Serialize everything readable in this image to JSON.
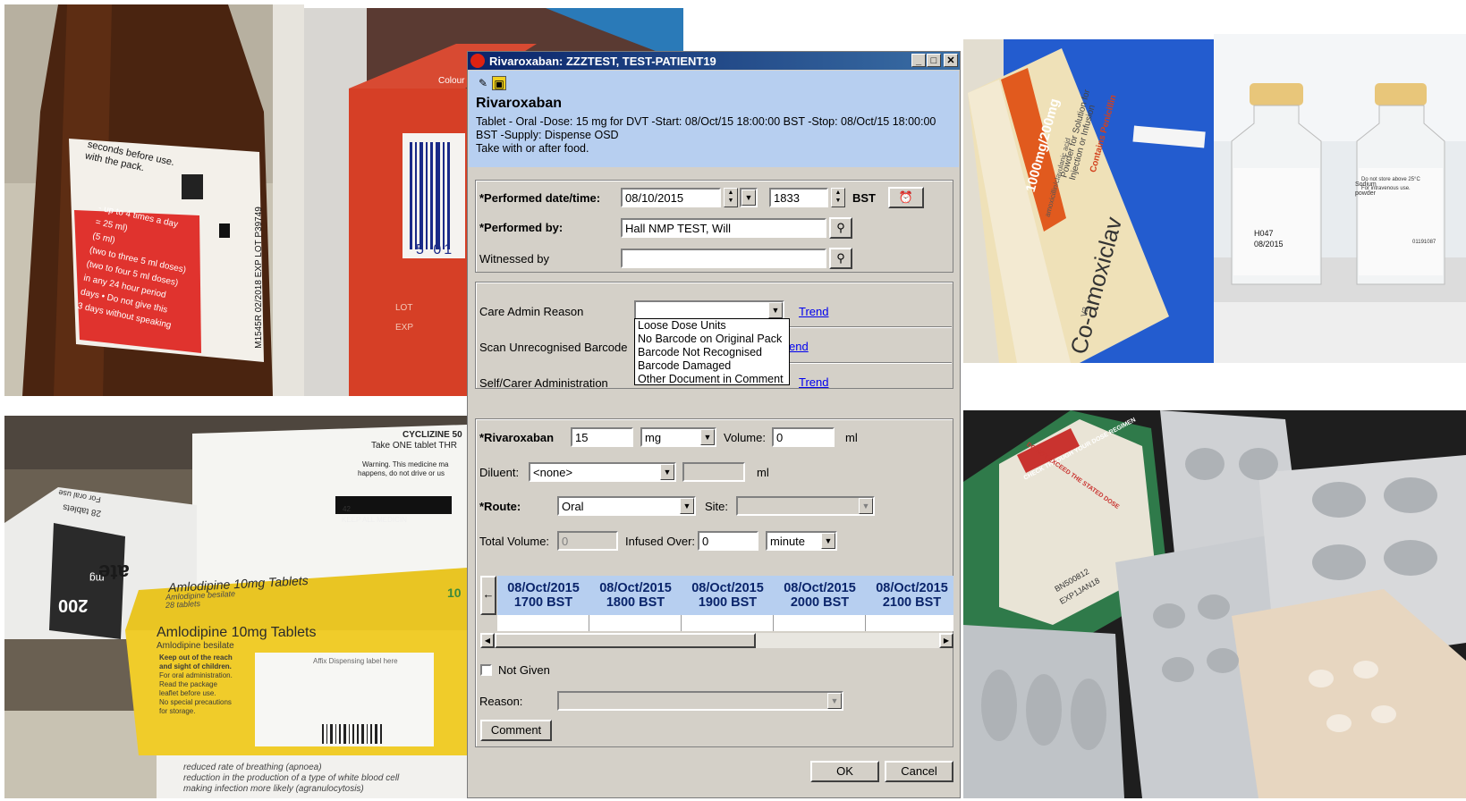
{
  "window": {
    "title": "Rivaroxaban: ZZZTEST, TEST-PATIENT19",
    "minimize": "_",
    "maximize": "□",
    "close": "✕"
  },
  "order": {
    "drug": "Rivaroxaban",
    "line1": "Tablet - Oral -Dose: 15 mg for DVT -Start: 08/Oct/15 18:00:00 BST -Stop: 08/Oct/15 18:00:00",
    "line2": "BST -Supply: Dispense OSD",
    "line3": "Take with or after food."
  },
  "performed": {
    "date_label": "*Performed date/time:",
    "date": "08/10/2015",
    "time": "1833",
    "tz": "BST",
    "by_label": "*Performed by:",
    "by": "Hall NMP TEST, Will",
    "witnessed_label": "Witnessed by",
    "witnessed": ""
  },
  "reasons": {
    "care_admin_label": "Care Admin Reason",
    "scan_label": "Scan Unrecognised Barcode",
    "self_label": "Self/Carer Administration",
    "trend": "Trend",
    "trend_partial": "end",
    "dropdown_options": [
      "Loose Dose Units",
      "No Barcode on Original Pack",
      "Barcode Not Recognised",
      "Barcode Damaged",
      "Other Document in Comment"
    ]
  },
  "dose": {
    "drug_label": "*Rivaroxaban",
    "amount": "15",
    "unit": "mg",
    "volume_label": "Volume:",
    "volume": "0",
    "volume_unit": "ml",
    "diluent_label": "Diluent:",
    "diluent": "<none>",
    "diluent_unit": "ml",
    "route_label": "*Route:",
    "route": "Oral",
    "site_label": "Site:",
    "site": "",
    "total_volume_label": "Total Volume:",
    "total_volume": "0",
    "infused_over_label": "Infused Over:",
    "infused_over": "0",
    "infused_unit": "minute"
  },
  "schedule": [
    {
      "date": "08/Oct/2015",
      "time": "1700 BST"
    },
    {
      "date": "08/Oct/2015",
      "time": "1800 BST"
    },
    {
      "date": "08/Oct/2015",
      "time": "1900 BST"
    },
    {
      "date": "08/Oct/2015",
      "time": "2000 BST"
    },
    {
      "date": "08/Oct/2015",
      "time": "2100 BST"
    }
  ],
  "not_given": {
    "label": "Not Given",
    "reason_label": "Reason:",
    "reason": "",
    "comment_button": "Comment"
  },
  "buttons": {
    "ok": "OK",
    "cancel": "Cancel"
  },
  "photos": {
    "top_left_bottle": [
      "seconds before use.",
      "with the pack.",
      "- up to 4 times a day",
      "= 25 ml)",
      "(5 ml)",
      "(two to three 5 ml doses)",
      "(two to four 5 ml doses)",
      "in any 24 hour period",
      "days • Do not give this",
      "3 days without speaking",
      "M1545R 02/2018",
      "EXP",
      "LOT",
      "P39749"
    ],
    "top_box": [
      "5 01",
      "LOT",
      "EXP",
      "Colour"
    ],
    "co_amoxiclav": [
      "1000mg/200mg",
      "Co-amoxiclav",
      "Powder for Solution for",
      "Injection or Infusion",
      "Contains Penicillin",
      "amoxicillin/clavulanic acid",
      "V2"
    ],
    "vials": [
      "H047",
      "08/2015",
      "Do not store above 25°C",
      "For intravenous use.",
      "01191087",
      "Sodium",
      "powder"
    ],
    "bottom_left": [
      "CYCLIZINE 50",
      "Take ONE tablet THR",
      "Warning. This medicine ma",
      "happens, do not drive or us",
      "KEEP ALL MEDICIN",
      "28 tablets",
      "For oral use",
      "Amlodipine 10mg Tablets",
      "Amlodipine besilate",
      "28 tablets",
      "Keep out of the reach",
      "and sight of children.",
      "For oral administration.",
      "Read the package",
      "leaflet before use.",
      "No special precautions",
      "for storage.",
      "Affix Dispensing label here",
      "200",
      "mg",
      "ate",
      "10",
      "42",
      "reduced rate of breathing (apnoea)",
      "reduction in the production of a type of white blood cell",
      "making infection more likely (agranulocytosis)"
    ],
    "blisters": [
      "CHECK THROUGH YOUR DOSE REGIMEN",
      "DO NOT EXCEED THE STATED DOSE",
      "BN500812",
      "EXP1JAN18"
    ]
  }
}
